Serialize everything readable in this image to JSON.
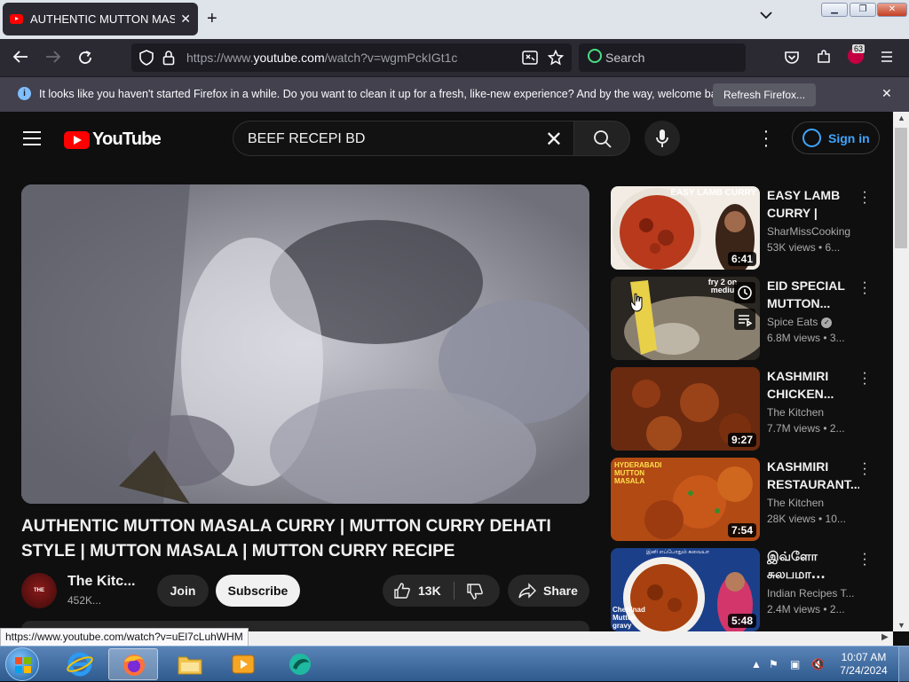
{
  "browser": {
    "tab_title": "AUTHENTIC MUTTON MASALA CURRY | MUTTON CURRY DEHATI STYLE",
    "new_tab_glyph": "+",
    "url_prefix": "https://www.",
    "url_domain": "youtube.com",
    "url_rest": "/watch?v=wgmPckIGt1c",
    "search_placeholder": "Search",
    "extensions_badge": "63"
  },
  "notification": {
    "message": "It looks like you haven't started Firefox in a while. Do you want to clean it up for a fresh, like-new experience? And by the way, welcome back!",
    "button_label": "Refresh Firefox..."
  },
  "youtube": {
    "logo_text": "YouTube",
    "search_query": "BEEF RECEPI BD",
    "sign_in_label": "Sign in",
    "video_title": "AUTHENTIC MUTTON MASALA CURRY | MUTTON CURRY DEHATI STYLE | MUTTON MASALA | MUTTON CURRY RECIPE",
    "channel_name": "The Kitc...",
    "channel_subs": "452K...",
    "channel_avatar_text": "THE KITCHEN",
    "join_label": "Join",
    "subscribe_label": "Subscribe",
    "likes": "13K",
    "share_label": "Share",
    "recommendations": [
      {
        "title": "EASY LAMB CURRY | India...",
        "channel": "SharMissCooking",
        "meta": "53K views • 6...",
        "duration": "6:41",
        "thumb_text": "EASY LAMB CURRY",
        "verified": false
      },
      {
        "title": "EID SPECIAL MUTTON...",
        "channel": "Spice Eats",
        "meta": "6.8M views • 3...",
        "duration": "",
        "thumb_text": "fry 2 on mediu",
        "verified": true
      },
      {
        "title": "KASHMIRI CHICKEN...",
        "channel": "The Kitchen",
        "meta": "7.7M views • 2...",
        "duration": "9:27",
        "thumb_text": "",
        "verified": false
      },
      {
        "title": "KASHMIRI RESTAURANT...",
        "channel": "The Kitchen",
        "meta": "28K views • 10...",
        "duration": "7:54",
        "thumb_text": "HYDERABADI MUTTON MASALA",
        "verified": false
      },
      {
        "title": "இவ்ளோ சுலபமா...",
        "channel": "Indian Recipes T...",
        "meta": "2.4M views • 2...",
        "duration": "5:48",
        "thumb_text": "Chettinad Mutton gravy",
        "verified": false
      }
    ]
  },
  "status_url": "https://www.youtube.com/watch?v=uEl7cLuhWHM",
  "taskbar": {
    "time": "10:07 AM",
    "date": "7/24/2024"
  }
}
